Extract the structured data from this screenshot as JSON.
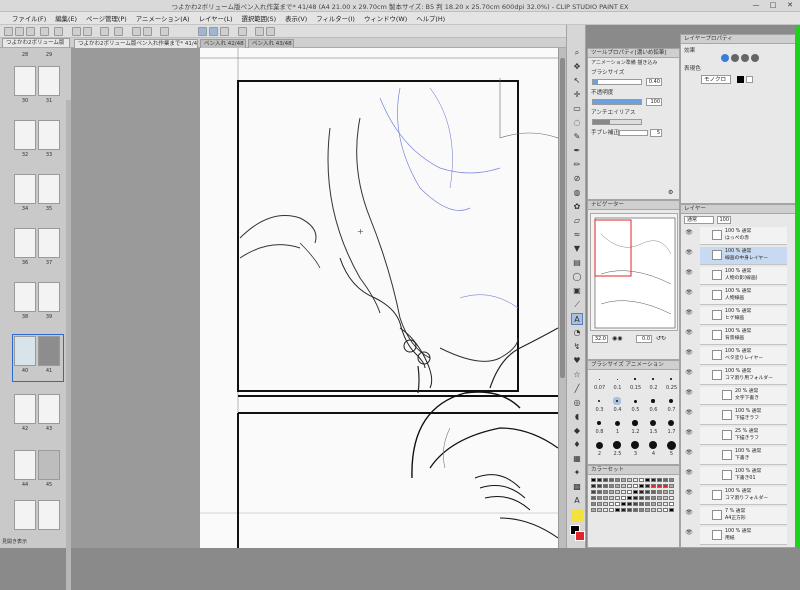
{
  "window": {
    "title": "つよかわ2ボリューム版ペン入れ作業まで* 41/48 (A4 21.00 x 29.70cm 製本サイズ: B5 判 18.20 x 25.70cm 600dpi 32.0%) - CLIP STUDIO PAINT EX",
    "minimize": "—",
    "maximize": "□",
    "close": "✕"
  },
  "menu": [
    "ファイル(F)",
    "編集(E)",
    "ページ管理(P)",
    "アニメーション(A)",
    "レイヤー(L)",
    "選択範囲(S)",
    "表示(V)",
    "フィルター(I)",
    "ウィンドウ(W)",
    "ヘルプ(H)"
  ],
  "tabs": [
    {
      "label": "つよかわ2ボリューム版ペン入れ作業まで* 41/48",
      "active": true
    },
    {
      "label": "ペン入れ 42/48",
      "active": false
    },
    {
      "label": "ペン入れ 43/48",
      "active": false
    }
  ],
  "page_panel": {
    "header": "つよかわ2ボリューム版",
    "page_numbers": [
      "28",
      "29",
      "30",
      "31",
      "32",
      "33",
      "34",
      "35",
      "36",
      "37",
      "38",
      "39",
      "40",
      "41",
      "42",
      "43",
      "44",
      "45",
      "46"
    ],
    "selected_page": "41",
    "footer": "見開き表示"
  },
  "tool_property": {
    "header": "ツールプロパティ[濃いめ鉛筆]",
    "subheader": "アニメーション準備 描き込み",
    "brush_size_label": "ブラシサイズ",
    "brush_size_value": "0.40",
    "opacity_label": "不透明度",
    "opacity_value": "100",
    "antialias_label": "アンチエイリアス",
    "stabilization_label": "手ブレ補正",
    "stabilization_value": "5"
  },
  "navigator": {
    "header": "ナビゲーター",
    "zoom_value": "32.0",
    "rotation_value": "0.0"
  },
  "brush_size_palette": {
    "header": "ブラシサイズ",
    "tab2": "アニメーション",
    "sizes": [
      "0.07",
      "0.1",
      "0.15",
      "0.2",
      "0.25",
      "0.3",
      "0.4",
      "0.5",
      "0.6",
      "0.7",
      "0.8",
      "1",
      "1.2",
      "1.5",
      "1.7",
      "2",
      "2.5",
      "3",
      "4",
      "5"
    ]
  },
  "color_set": {
    "header": "カラーセット"
  },
  "color_panel": {
    "header": "レイヤープロパティ",
    "effect_label": "効果",
    "expression_label": "表現色",
    "expression_value": "モノクロ",
    "main_color": "#000000",
    "sub_color": "#ffffff",
    "accent_red": "#e0262a"
  },
  "layers": {
    "header": "レイヤー",
    "blend_mode": "通常",
    "opacity": "100",
    "items": [
      {
        "meta": "100 % 通常",
        "name": "ほっぺの赤"
      },
      {
        "meta": "100 % 通常",
        "name": "線画の中身レイヤー"
      },
      {
        "meta": "100 % 通常",
        "name": "人物の影(線画)"
      },
      {
        "meta": "100 % 通常",
        "name": "人物線画"
      },
      {
        "meta": "100 % 通常",
        "name": "ヒゲ線画"
      },
      {
        "meta": "100 % 通常",
        "name": "背景線画"
      },
      {
        "meta": "100 % 通常",
        "name": "ベタ塗りレイヤー"
      },
      {
        "meta": "100 % 通常",
        "name": "コマ割り用フォルダー"
      },
      {
        "meta": "20 % 通常",
        "name": "文字下書き"
      },
      {
        "meta": "100 % 通常",
        "name": "下描きラフ"
      },
      {
        "meta": "25 % 通常",
        "name": "下描きラフ"
      },
      {
        "meta": "100 % 通常",
        "name": "下書き"
      },
      {
        "meta": "100 % 通常",
        "name": "下書き01"
      },
      {
        "meta": "100 % 通常",
        "name": "コマ割りフォルダー"
      },
      {
        "meta": "7 % 通常",
        "name": "A4正方形"
      },
      {
        "meta": "100 % 通常",
        "name": "用紙"
      }
    ],
    "selected_index": 1
  }
}
